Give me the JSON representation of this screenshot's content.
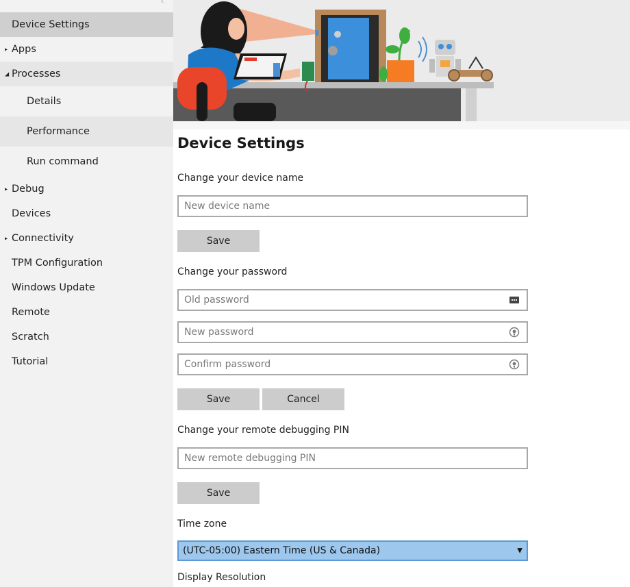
{
  "sidebar": {
    "collapse_glyph": "‹",
    "items": [
      {
        "label": "Device Settings"
      },
      {
        "label": "Apps",
        "arrow": "▸"
      },
      {
        "label": "Processes",
        "arrow": "◢"
      },
      {
        "label": "Details"
      },
      {
        "label": "Performance"
      },
      {
        "label": "Run command"
      },
      {
        "label": "Debug",
        "arrow": "▸"
      },
      {
        "label": "Devices"
      },
      {
        "label": "Connectivity",
        "arrow": "▸"
      },
      {
        "label": "TPM Configuration"
      },
      {
        "label": "Windows Update"
      },
      {
        "label": "Remote"
      },
      {
        "label": "Scratch"
      },
      {
        "label": "Tutorial"
      }
    ]
  },
  "main": {
    "title": "Device Settings",
    "device_name": {
      "label": "Change your device name",
      "placeholder": "New device name",
      "save": "Save"
    },
    "password": {
      "label": "Change your password",
      "old_placeholder": "Old password",
      "new_placeholder": "New password",
      "confirm_placeholder": "Confirm password",
      "save": "Save",
      "cancel": "Cancel"
    },
    "pin": {
      "label": "Change your remote debugging PIN",
      "placeholder": "New remote debugging PIN",
      "save": "Save"
    },
    "timezone": {
      "label": "Time zone",
      "value": "(UTC-05:00) Eastern Time (US & Canada)",
      "caret": "▼"
    },
    "display": {
      "label": "Display Resolution"
    }
  },
  "icons": {
    "password_dots": "password-dots-icon",
    "reveal": "reveal-password-icon"
  },
  "colors": {
    "sidebar_bg": "#f2f2f2",
    "selected_bg": "#cfcfcf",
    "button_bg": "#cccccc",
    "select_bg": "#9dc7ec",
    "select_border": "#5b9bd5"
  }
}
